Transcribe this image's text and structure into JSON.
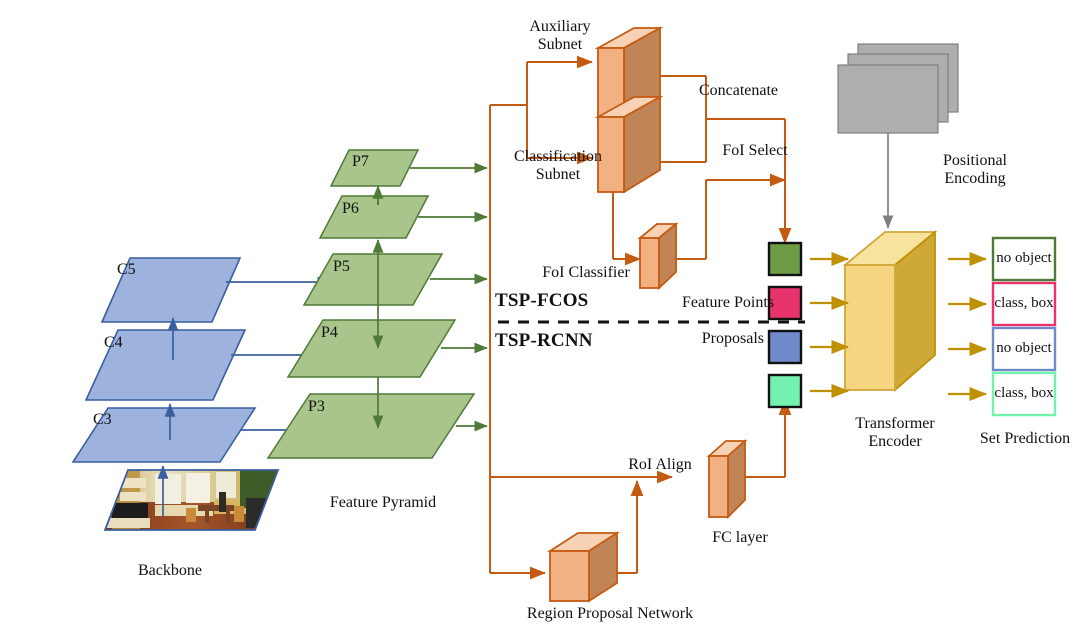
{
  "figure": {
    "title": "TSP-FCOS / TSP-RCNN detection architecture",
    "colors": {
      "backbone_fill": "#9DB2DC",
      "backbone_stroke": "#3A5FA0",
      "pyramid_fill": "#A9C58B",
      "pyramid_stroke": "#4F7A37",
      "orange_stroke": "#C55A11",
      "cube_front": "#F2B183",
      "cube_side": "#C08457",
      "cube_top": "#F7D2B4",
      "encoder_front": "#F5D580",
      "encoder_side": "#CFA83A",
      "encoder_top": "#F8E39E",
      "gray_fill": "#AEAEAE",
      "gray_stroke": "#7F7F7F",
      "arrow_gold": "#BF9000",
      "token_green": "#6E9B45",
      "token_pink": "#E8336D",
      "token_blue": "#7089C8",
      "token_mint": "#74F1AE",
      "pred_green": "#4F7A37",
      "pred_pink": "#E8336D",
      "pred_blue": "#7089C8",
      "pred_mint": "#74F1AE"
    }
  },
  "backbone": {
    "caption": "Backbone",
    "levels": [
      {
        "label": "C5"
      },
      {
        "label": "C4"
      },
      {
        "label": "C3"
      }
    ],
    "input_image": "living-room-photo"
  },
  "pyramid": {
    "caption": "Feature Pyramid",
    "levels": [
      {
        "label": "P7"
      },
      {
        "label": "P6"
      },
      {
        "label": "P5"
      },
      {
        "label": "P4"
      },
      {
        "label": "P3"
      }
    ]
  },
  "fcos_branch": {
    "auxiliary_subnet": "Auxiliary\nSubnet",
    "classification_subnet": "Classification\nSubnet",
    "concatenate": "Concatenate",
    "foi_select": "FoI Select",
    "foi_classifier": "FoI Classifier"
  },
  "rcnn_branch": {
    "roi_align": "RoI Align",
    "fc_layer": "FC layer",
    "region_proposal_network": "Region Proposal Network"
  },
  "divider": {
    "top_label": "TSP-FCOS",
    "bottom_label": "TSP-RCNN"
  },
  "tokens": {
    "feature_points_label": "Feature Points",
    "proposals_label": "Proposals",
    "items": [
      {
        "name": "feature-point-token-green",
        "color": "#6E9B45"
      },
      {
        "name": "feature-point-token-pink",
        "color": "#E8336D"
      },
      {
        "name": "proposal-token-blue",
        "color": "#7089C8"
      },
      {
        "name": "proposal-token-mint",
        "color": "#74F1AE"
      }
    ]
  },
  "positional_encoding": {
    "label": "Positional\nEncoding",
    "sheets": 3
  },
  "encoder": {
    "caption": "Transformer\nEncoder"
  },
  "set_prediction": {
    "caption": "Set Prediction",
    "items": [
      {
        "text": "no\nobject",
        "border": "#4F7A37"
      },
      {
        "text": "class,\nbox",
        "border": "#E8336D"
      },
      {
        "text": "no\nobject",
        "border": "#7089C8"
      },
      {
        "text": "class,\nbox",
        "border": "#74F1AE"
      }
    ]
  }
}
